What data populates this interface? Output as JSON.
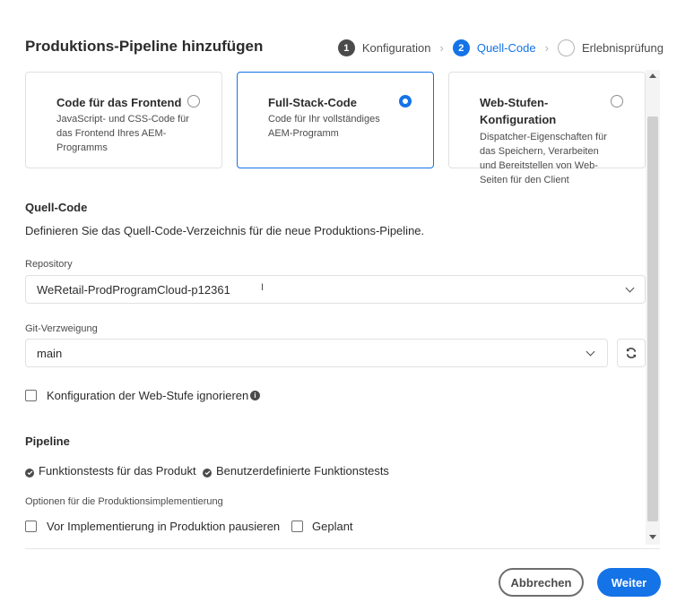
{
  "dialog": {
    "title": "Produktions-Pipeline hinzufügen",
    "steps": [
      {
        "number": "1",
        "label": "Konfiguration",
        "state": "done"
      },
      {
        "number": "2",
        "label": "Quell-Code",
        "state": "active"
      },
      {
        "number": "",
        "label": "Erlebnisprüfung",
        "state": "pending"
      }
    ]
  },
  "cards": [
    {
      "title": "Code für das Frontend",
      "description": "JavaScript- und CSS-Code für das Frontend Ihres AEM-Programms",
      "selected": false
    },
    {
      "title": "Full-Stack-Code",
      "description": "Code für Ihr vollständiges AEM-Programm",
      "selected": true
    },
    {
      "title": "Web-Stufen-Konfiguration",
      "description": "Dispatcher-Eigenschaften für das Speichern, Verarbeiten und Bereitstellen von Web-Seiten für den Client",
      "selected": false
    }
  ],
  "source": {
    "heading": "Quell-Code",
    "description": "Definieren Sie das Quell-Code-Verzeichnis für die neue Produktions-Pipeline.",
    "repository_label": "Repository",
    "repository_value": "WeRetail-ProdProgramCloud-p12361",
    "repository_cursor": "I",
    "branch_label": "Git-Verzweigung",
    "branch_value": "main",
    "ignore_web_tier_label": "Konfiguration der Web-Stufe ignorieren"
  },
  "pipeline": {
    "heading": "Pipeline",
    "tests": [
      "Funktionstests für das Produkt",
      "Benutzerdefinierte Funktionstests"
    ],
    "deploy_options_label": "Optionen für die Produktionsimplementierung",
    "pause_label": "Vor Implementierung in Produktion pausieren",
    "scheduled_label": "Geplant"
  },
  "footer": {
    "cancel_label": "Abbrechen",
    "next_label": "Weiter"
  },
  "colors": {
    "accent": "#1473e6",
    "text": "#2c2c2c",
    "border": "#e1e1e1"
  }
}
